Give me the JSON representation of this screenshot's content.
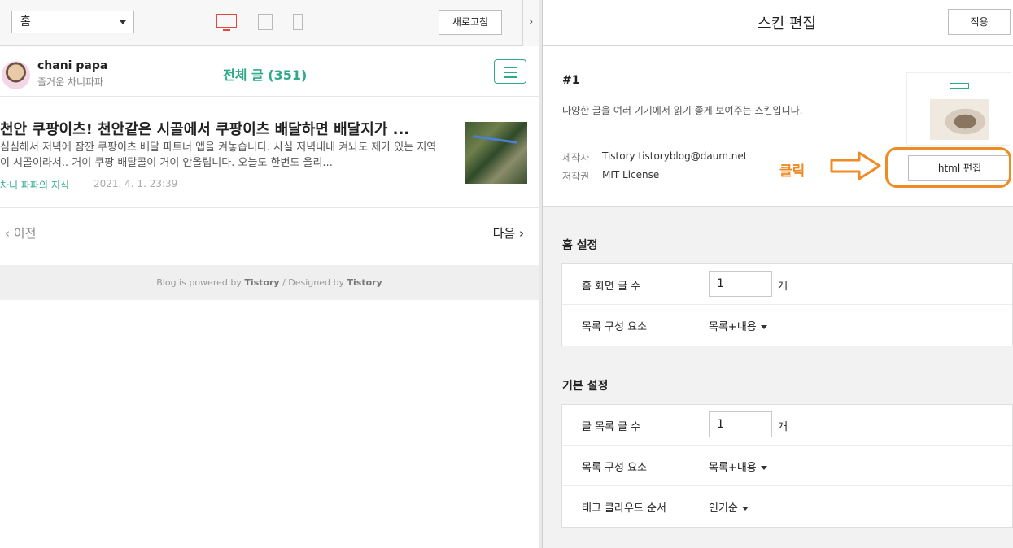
{
  "toolbar": {
    "page_select": "홈",
    "devices": [
      "desktop",
      "tablet",
      "mobile"
    ],
    "refresh_label": "새로고침",
    "collapse_glyph": "›"
  },
  "blog": {
    "name": "chani papa",
    "subtitle": "즐거운 차니파파",
    "count_label": "전체 글 (351)"
  },
  "post": {
    "title": "천안 쿠팡이츠! 천안같은 시골에서 쿠팡이츠 배달하면 배달지가 ...",
    "excerpt": "심심해서 저녁에 잠깐 쿠팡이츠 배달 파트너 앱을 켜놓습니다. 사실 저녁내내 켜놔도 제가 있는 지역이 시골이라서.. 거이 쿠팡 배달콜이 거이 안올립니다. 오늘도 한번도 올리...",
    "category": "차니 파파의 지식",
    "date": "2021. 4. 1. 23:39"
  },
  "paging": {
    "prev": "이전",
    "next": "다음"
  },
  "footer": {
    "powered_prefix": "Blog is powered by ",
    "powered_brand": "Tistory",
    "designed_prefix": " / Designed by ",
    "designed_brand": "Tistory"
  },
  "editor": {
    "title": "스킨 편집",
    "apply_label": "적용",
    "skin_number": "#1",
    "skin_description": "다양한 글을 여러 기기에서 읽기 좋게 보여주는 스킨입니다.",
    "maker_label": "제작자",
    "maker_value": "Tistory tistoryblog@daum.net",
    "license_label": "저작권",
    "license_value": "MIT License",
    "click_annotation": "클릭",
    "html_edit_label": "html 편집",
    "home_settings": {
      "title": "홈 설정",
      "rows": [
        {
          "label": "홈 화면 글 수",
          "value": "1",
          "unit": "개"
        },
        {
          "label": "목록 구성 요소",
          "value": "목록+내용"
        }
      ]
    },
    "basic_settings": {
      "title": "기본 설정",
      "rows": [
        {
          "label": "글 목록 글 수",
          "value": "1",
          "unit": "개"
        },
        {
          "label": "목록 구성 요소",
          "value": "목록+내용"
        },
        {
          "label": "태그 클라우드 순서",
          "value": "인기순"
        }
      ]
    }
  },
  "colors": {
    "accent": "#2fa98c",
    "highlight": "#f08a24",
    "active_device": "#e2483d"
  }
}
